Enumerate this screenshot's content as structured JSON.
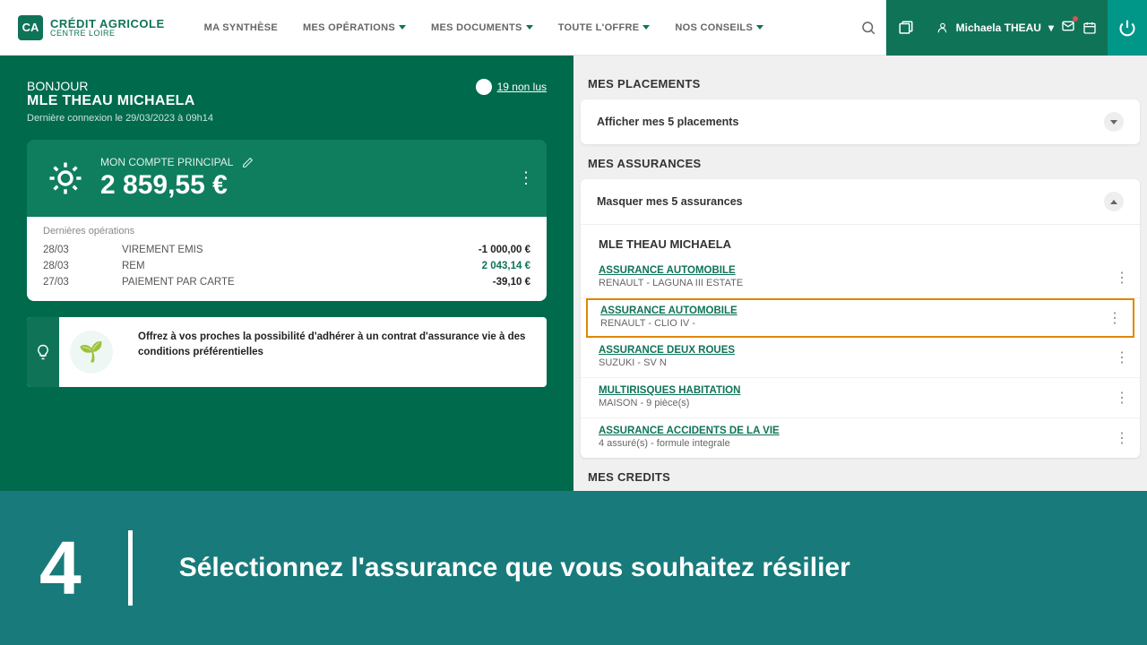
{
  "logo": {
    "main": "CRÉDIT AGRICOLE",
    "sub": "CENTRE LOIRE",
    "icon": "CA"
  },
  "nav": {
    "synthesis": "MA SYNTHÈSE",
    "operations": "MES OPÉRATIONS",
    "documents": "MES DOCUMENTS",
    "offers": "TOUTE L'OFFRE",
    "advice": "NOS CONSEILS"
  },
  "user": {
    "name": "Michaela THEAU"
  },
  "greeting": {
    "hello": "BONJOUR",
    "name": "MLE THEAU MICHAELA",
    "last_connection": "Dernière connexion le 29/03/2023 à 09h14",
    "unread": "19 non lus"
  },
  "account": {
    "title": "MON COMPTE PRINCIPAL",
    "balance": "2 859,55 €",
    "ops_title": "Dernières opérations",
    "ops": [
      {
        "date": "28/03",
        "label": "VIREMENT EMIS",
        "amount": "-1 000,00 €",
        "sign": "neg"
      },
      {
        "date": "28/03",
        "label": "REM",
        "amount": "2 043,14 €",
        "sign": "pos"
      },
      {
        "date": "27/03",
        "label": "PAIEMENT PAR CARTE",
        "amount": "-39,10 €",
        "sign": "neg"
      }
    ]
  },
  "promo": {
    "text": "Offrez à vos proches la possibilité d'adhérer à un contrat d'assurance vie à des conditions préférentielles"
  },
  "placements": {
    "title": "MES PLACEMENTS",
    "toggle": "Afficher mes 5 placements"
  },
  "assurances": {
    "title": "MES ASSURANCES",
    "toggle": "Masquer mes 5 assurances",
    "owner": "MLE THEAU MICHAELA",
    "items": [
      {
        "link": "ASSURANCE AUTOMOBILE",
        "detail": "RENAULT - LAGUNA III ESTATE",
        "highlighted": false
      },
      {
        "link": "ASSURANCE AUTOMOBILE",
        "detail": "RENAULT - CLIO IV -",
        "highlighted": true
      },
      {
        "link": "ASSURANCE DEUX ROUES",
        "detail": "SUZUKI - SV N",
        "highlighted": false
      },
      {
        "link": "MULTIRISQUES HABITATION",
        "detail": "MAISON - 9 pièce(s)",
        "highlighted": false
      },
      {
        "link": "ASSURANCE ACCIDENTS DE LA VIE",
        "detail": "4 assuré(s) - formule integrale",
        "highlighted": false
      }
    ]
  },
  "credits": {
    "title": "MES CREDITS"
  },
  "instruction": {
    "number": "4",
    "text": "Sélectionnez l'assurance que vous souhaitez résilier"
  }
}
